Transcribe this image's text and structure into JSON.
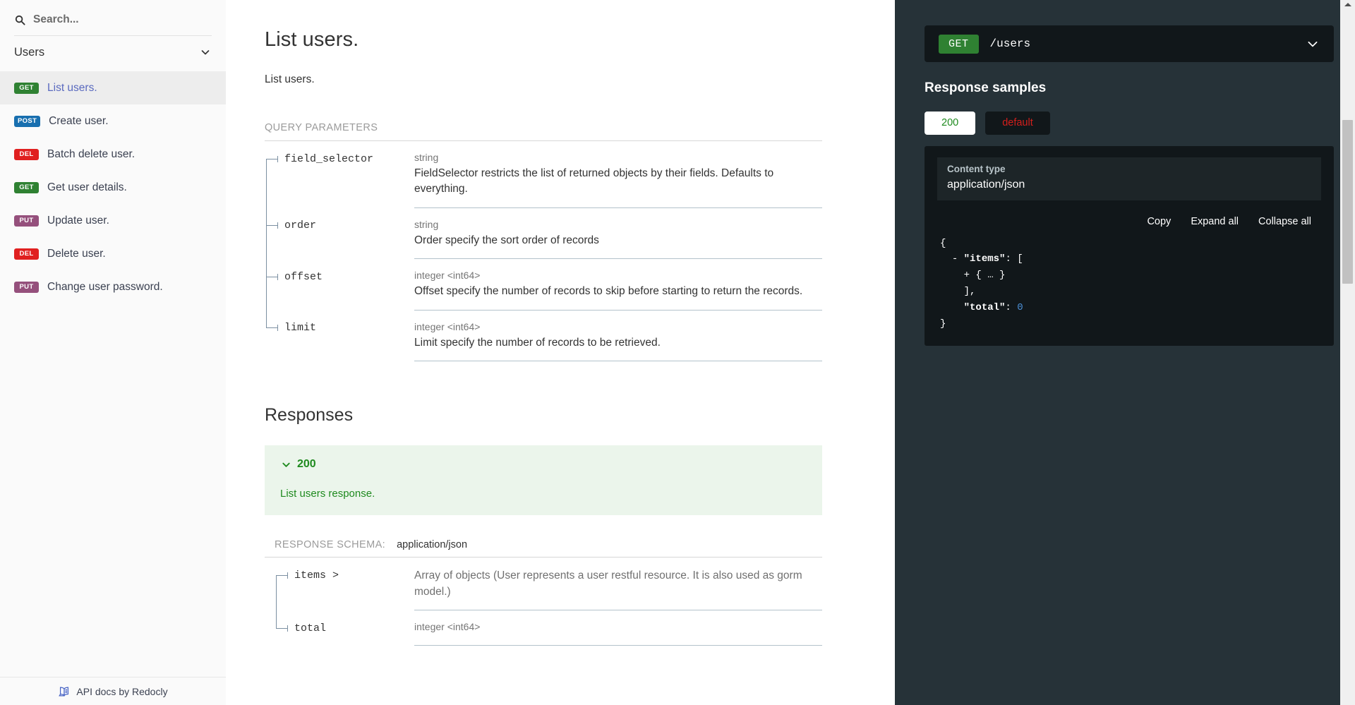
{
  "sidebar": {
    "search": {
      "placeholder": "Search...",
      "value": "",
      "icon": "search-icon"
    },
    "group": {
      "label": "Users",
      "icon": "chevron-down-icon"
    },
    "items": [
      {
        "method": "GET",
        "method_class": "get",
        "label": "List users.",
        "active": true
      },
      {
        "method": "POST",
        "method_class": "post",
        "label": "Create user.",
        "active": false
      },
      {
        "method": "DEL",
        "method_class": "del",
        "label": "Batch delete user.",
        "active": false
      },
      {
        "method": "GET",
        "method_class": "get",
        "label": "Get user details.",
        "active": false
      },
      {
        "method": "PUT",
        "method_class": "put",
        "label": "Update user.",
        "active": false
      },
      {
        "method": "DEL",
        "method_class": "del",
        "label": "Delete user.",
        "active": false
      },
      {
        "method": "PUT",
        "method_class": "put",
        "label": "Change user password.",
        "active": false
      }
    ],
    "footer": {
      "text": "API docs by Redocly",
      "icon": "redocly-logo-icon"
    }
  },
  "main": {
    "title": "List users.",
    "description": "List users.",
    "query_parameters_caption": "QUERY PARAMETERS",
    "query_parameters": [
      {
        "name": "field_selector",
        "type": "string",
        "description": "FieldSelector restricts the list of returned objects by their fields. Defaults to everything."
      },
      {
        "name": "order",
        "type": "string",
        "description": "Order specify the sort order of records"
      },
      {
        "name": "offset",
        "type": "integer <int64>",
        "description": "Offset specify the number of records to skip before starting to return the records."
      },
      {
        "name": "limit",
        "type": "integer <int64>",
        "description": "Limit specify the number of records to be retrieved."
      }
    ],
    "responses_title": "Responses",
    "response": {
      "code": "200",
      "description": "List users response.",
      "chevron": "chevron-down-icon"
    },
    "response_schema_label": "RESPONSE SCHEMA:",
    "response_schema_value": "application/json",
    "schema_rows": [
      {
        "name": "items >",
        "type": "",
        "description": "Array of objects (User represents a user restful resource. It is also used as gorm model.)"
      },
      {
        "name": "total",
        "type": "integer <int64>",
        "description": ""
      }
    ]
  },
  "right_panel": {
    "endpoint": {
      "method": "GET",
      "path": "/users",
      "chevron": "chevron-down-icon"
    },
    "heading": "Response samples",
    "tabs": [
      {
        "label": "200",
        "active": true
      },
      {
        "label": "default",
        "active": false
      }
    ],
    "content_type_label": "Content type",
    "content_type_value": "application/json",
    "actions": [
      "Copy",
      "Expand all",
      "Collapse all"
    ],
    "code_sample": {
      "lines": [
        {
          "indent": 0,
          "toggle": "",
          "text": "{"
        },
        {
          "indent": 1,
          "toggle": "-",
          "key": "\"items\"",
          "after": ": ["
        },
        {
          "indent": 2,
          "toggle": "+",
          "text": "{ … }"
        },
        {
          "indent": 1,
          "toggle": "",
          "text": "],"
        },
        {
          "indent": 1,
          "toggle": "",
          "key": "\"total\"",
          "after": ": ",
          "num": "0"
        },
        {
          "indent": 0,
          "toggle": "",
          "text": "}"
        }
      ]
    }
  },
  "colors": {
    "get": "#2f8132",
    "post": "#186faf",
    "del": "#e02020",
    "put": "#95507c",
    "panel_bg": "#263238",
    "code_bg": "#11171a",
    "success": "#1e8a1e",
    "error": "#d41f1c",
    "active_link": "#5a6abf"
  },
  "scrollbar": {
    "present": true
  }
}
